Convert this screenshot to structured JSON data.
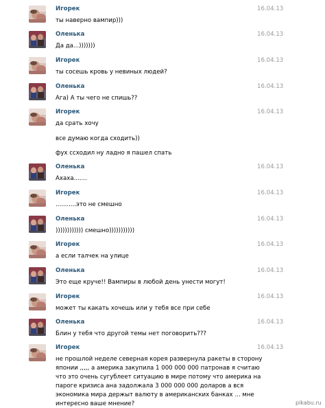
{
  "messages": [
    {
      "author": "Игорек",
      "avatar": "avatar-igorek",
      "date": "16.04.13",
      "lines": [
        "ты наверно вампир)))"
      ]
    },
    {
      "author": "Оленька",
      "avatar": "avatar-olenka",
      "date": "16.04.13",
      "lines": [
        "Да да...)))))))"
      ]
    },
    {
      "author": "Игорек",
      "avatar": "avatar-igorek",
      "date": "16.04.13",
      "lines": [
        "ты сосешь кровь у невиных людей?"
      ]
    },
    {
      "author": "Оленька",
      "avatar": "avatar-olenka",
      "date": "16.04.13",
      "lines": [
        "Ага) А ты чего не спишь??"
      ]
    },
    {
      "author": "Игорек",
      "avatar": "avatar-igorek",
      "date": "16.04.13",
      "lines": [
        "да срать хочу",
        "все думаю когда сходить))",
        "фух ссходил ну ладно я пашел спать"
      ]
    },
    {
      "author": "Оленька",
      "avatar": "avatar-olenka",
      "date": "16.04.13",
      "lines": [
        "Ахаха......."
      ]
    },
    {
      "author": "Игорек",
      "avatar": "avatar-igorek",
      "date": "16.04.13",
      "lines": [
        "...........это не смешно"
      ]
    },
    {
      "author": "Оленька",
      "avatar": "avatar-olenka",
      "date": "16.04.13",
      "lines": [
        ")))))))))))) смешно)))))))))))"
      ]
    },
    {
      "author": "Игорек",
      "avatar": "avatar-igorek",
      "date": "16.04.13",
      "lines": [
        "а если талчек на улице"
      ]
    },
    {
      "author": "Оленька",
      "avatar": "avatar-olenka",
      "date": "16.04.13",
      "lines": [
        "Это еще круче!! Вампиры в любой день унести могут!"
      ]
    },
    {
      "author": "Игорек",
      "avatar": "avatar-igorek",
      "date": "16.04.13",
      "lines": [
        "может ты какать хочешь или у тебя все при себе"
      ]
    },
    {
      "author": "Оленька",
      "avatar": "avatar-olenka",
      "date": "16.04.13",
      "lines": [
        "Блин у тебя что другой темы нет поговорить???"
      ]
    },
    {
      "author": "Игорек",
      "avatar": "avatar-igorek",
      "date": "16.04.13",
      "lines": [
        "не прошлой неделе северная корея развернула ракеты в сторону",
        "японии ,,,,, а америка закупила 1 000 000 000 патронав я считаю",
        "что это очень сугублеет ситуацию в мире потому что америка на",
        "пароге кризиса ана задолжала 3 000 000 000 доларов а вся",
        "экономика мира держыт валюту в американских банках ... мне",
        "интересно ваше мнение?"
      ]
    }
  ],
  "watermark": "pikabu.ru"
}
